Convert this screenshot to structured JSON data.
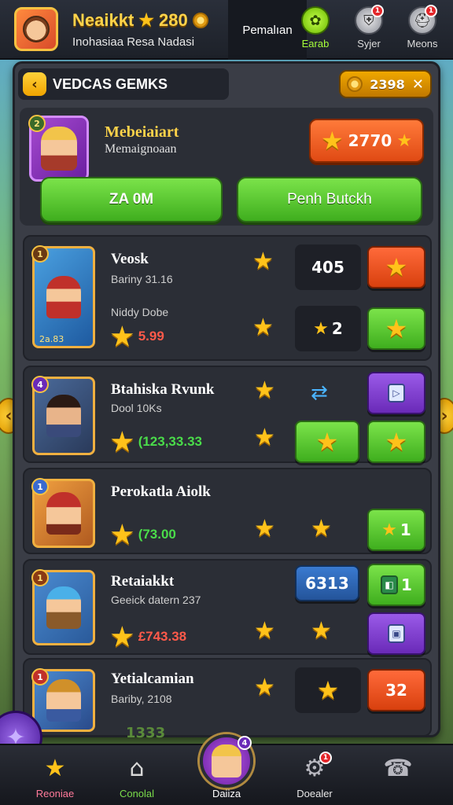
{
  "topbar": {
    "player_name": "Neaikkt",
    "player_score": "280",
    "player_subtitle": "Inohasiaa Resa Nadasi",
    "active_tab": "Pemalıan",
    "icons": [
      {
        "label": "Earab",
        "icon": "green-gear-icon",
        "badge": ""
      },
      {
        "label": "Syjer",
        "icon": "shield-icon",
        "badge": "1"
      },
      {
        "label": "Meons",
        "icon": "helmet-icon",
        "badge": "1"
      }
    ]
  },
  "panel": {
    "title": "VEDCAS GEMKS",
    "currency_value": "2398",
    "hero": {
      "level": "2",
      "name": "Mebeiaiart",
      "subtitle": "Memaignoaan",
      "price": "2770",
      "button1": "ZA 0M",
      "button2": "Penh Butckh"
    },
    "rows": [
      {
        "title": "Veosk",
        "subtitle": "Bariny 31.16",
        "subtitle2": "Niddy Dobe",
        "price": "5.99",
        "portrait_caption": "2a.83",
        "level": "1",
        "box1": "405",
        "box2": "2"
      },
      {
        "title": "Btahiska Rvunk",
        "subtitle": "Dool 10Ks",
        "price": "(123,33.33",
        "level": "4"
      },
      {
        "title": "Perokatla Aiolk",
        "price": "(73.00",
        "level": "1",
        "btn": "1"
      },
      {
        "title": "Retaiakkt",
        "subtitle": "Geeick datern 237",
        "price": "£743.38",
        "level": "1",
        "box": "6313",
        "btn": "1"
      },
      {
        "title": "Yetialcamian",
        "subtitle": "Bariby, 2108",
        "level": "1",
        "btn": "32"
      }
    ]
  },
  "bottom_peek": {
    "value": "1333"
  },
  "bottom_nav": [
    {
      "label": "Reoniae",
      "icon": "star-icon"
    },
    {
      "label": "Conolal",
      "icon": "home-icon"
    },
    {
      "label": "Daiiza",
      "icon": "hero-avatar-icon",
      "badge": "4"
    },
    {
      "label": "Doealer",
      "icon": "gear-icon",
      "badge": "1"
    },
    {
      "label": "",
      "icon": "phone-icon"
    }
  ],
  "colors": {
    "gold": "#ffc21a",
    "green": "#3fae1e",
    "orange": "#e04a14",
    "purple": "#6a2ab8",
    "panel": "#3a3d46"
  }
}
